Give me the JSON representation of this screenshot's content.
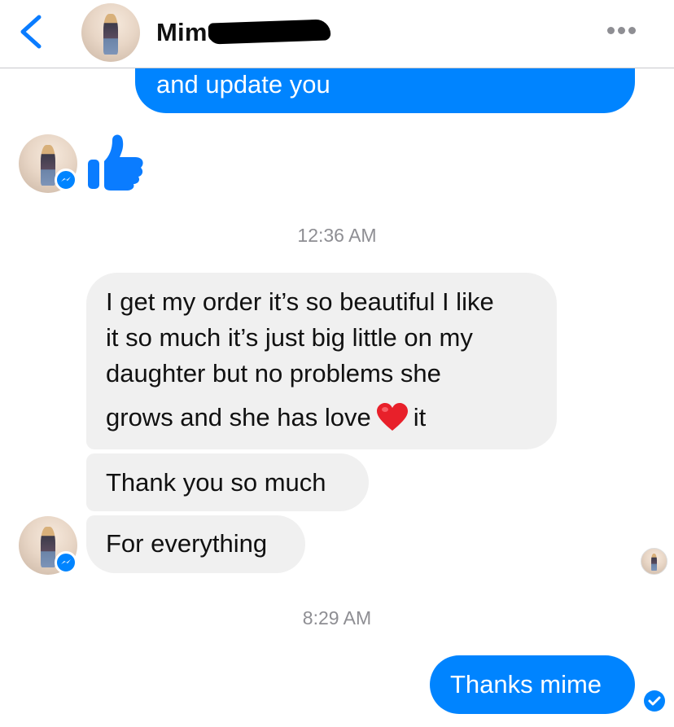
{
  "header": {
    "contact_name": "Mime",
    "back_icon": "chevron-left-icon",
    "more_icon": "more-dots-icon"
  },
  "messages": {
    "outgoing_1": "and update you",
    "timestamp_1": "12:36 AM",
    "incoming_1": {
      "line1": "I get my order it’s so beautiful I like",
      "line2": "it so much it’s just big little on my",
      "line3": "daughter but no problems she",
      "line4_before": "grows and she has love",
      "line4_after": "it"
    },
    "incoming_2": "Thank you so much",
    "incoming_3": "For everything",
    "timestamp_2": "8:29 AM",
    "outgoing_2": "Thanks mime"
  },
  "colors": {
    "accent_blue": "#0084ff",
    "incoming_bubble": "#f0f0f0",
    "timestamp_grey": "#8e8e93"
  }
}
